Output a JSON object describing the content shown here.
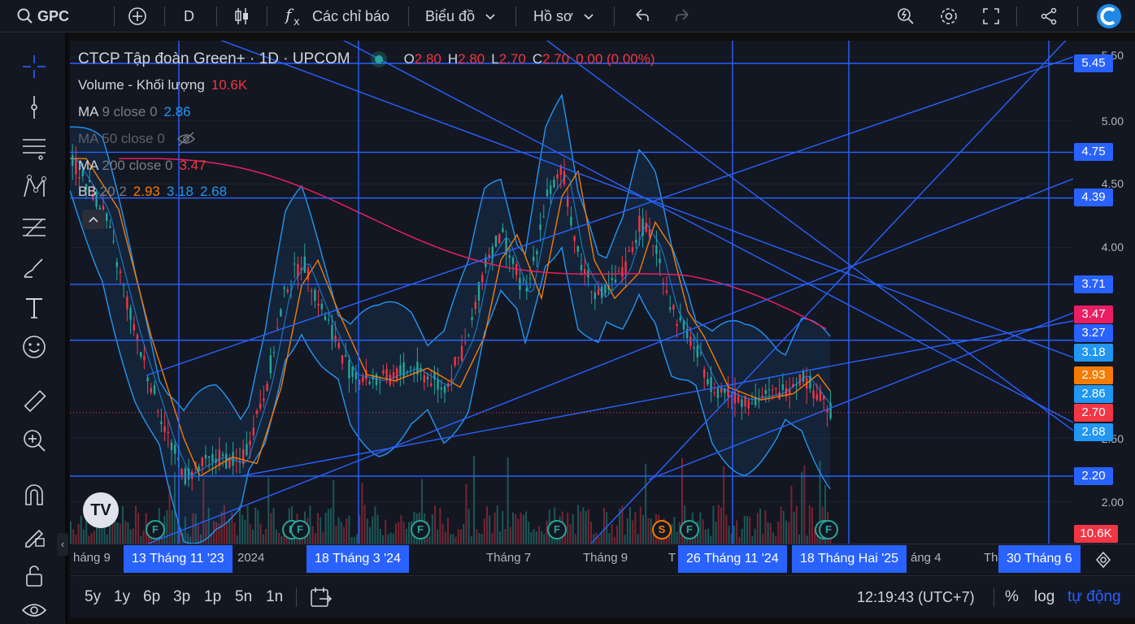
{
  "header": {
    "symbol": "GPC",
    "interval": "D",
    "indicators_label": "Các chỉ báo",
    "chart_label": "Biểu đồ",
    "profile_label": "Hồ sơ"
  },
  "legend": {
    "title": "CTCP Tập đoàn Green+ · 1D · UPCOM",
    "ohlc": {
      "o_label": "O",
      "o": "2.80",
      "h_label": "H",
      "h": "2.80",
      "l_label": "L",
      "l": "2.70",
      "c_label": "C",
      "c": "2.70",
      "change": "0.00 (0.00%)"
    },
    "volume": {
      "label": "Volume - Khối lượng",
      "value": "10.6K"
    },
    "ma9": {
      "label": "MA",
      "params": "9 close 0",
      "value": "2.86"
    },
    "ma50": {
      "label": "MA 50 close 0"
    },
    "ma200": {
      "label": "MA",
      "params": "200 close 0",
      "value": "3.47"
    },
    "bb": {
      "label": "BB",
      "params": "20 2",
      "v1": "2.93",
      "v2": "3.18",
      "v3": "2.68"
    }
  },
  "price_scale": {
    "ticks": [
      "5.50",
      "5.00",
      "4.50",
      "4.00",
      "2.50",
      "2.00"
    ],
    "badges": [
      {
        "text": "5.45",
        "color": "#2962ff"
      },
      {
        "text": "4.75",
        "color": "#2962ff"
      },
      {
        "text": "4.39",
        "color": "#2962ff"
      },
      {
        "text": "3.71",
        "color": "#2962ff"
      },
      {
        "text": "3.47",
        "color": "#e91e63"
      },
      {
        "text": "3.27",
        "color": "#2962ff"
      },
      {
        "text": "3.18",
        "color": "#2196f3"
      },
      {
        "text": "2.93",
        "color": "#f57c00"
      },
      {
        "text": "2.86",
        "color": "#2196f3"
      },
      {
        "text": "2.70",
        "color": "#f23645"
      },
      {
        "text": "2.68",
        "color": "#2196f3"
      },
      {
        "text": "2.20",
        "color": "#2962ff"
      },
      {
        "text": "10.6K",
        "color": "#f23645"
      }
    ]
  },
  "time_scale": {
    "ticks": [
      "háng 9",
      "2024",
      "Tháng 7",
      "Tháng 9",
      "T",
      "áng 4",
      "Th"
    ],
    "badges": [
      "13 Tháng 11 '23",
      "18 Tháng 3 '24",
      "26 Tháng 11 '24",
      "18 Tháng Hai '25",
      "30 Tháng 6"
    ]
  },
  "markers": {
    "f": "F",
    "s": "S"
  },
  "bottom": {
    "ranges": [
      "5y",
      "1y",
      "6p",
      "3p",
      "1p",
      "5n",
      "1n"
    ],
    "clock": "12:19:43 (UTC+7)",
    "percent": "%",
    "log": "log",
    "auto": "tự động"
  },
  "colors": {
    "drawing_line": "#2962ff",
    "ma9": "#2196f3",
    "ma200": "#e91e63",
    "bb_basis": "#f57c00",
    "bb_band": "#2196f3",
    "up": "#26a69a",
    "down": "#f23645"
  },
  "icons": {
    "search": "search-icon",
    "add": "plus-circle-icon",
    "candles": "candlestick-icon",
    "fx": "fx-icon",
    "undo": "undo-icon",
    "redo": "redo-icon",
    "quick_search": "lightning-search-icon",
    "settings": "gear-icon",
    "fullscreen": "fullscreen-icon",
    "share": "share-icon"
  }
}
